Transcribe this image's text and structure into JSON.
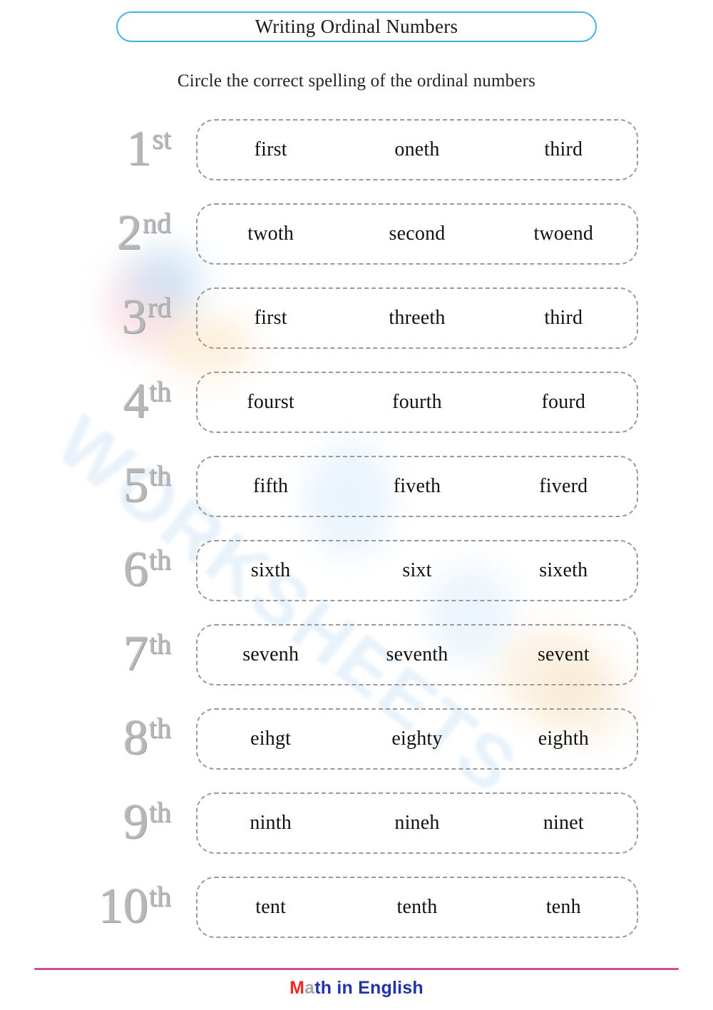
{
  "page": {
    "title": "Writing Ordinal Numbers",
    "instruction": "Circle the correct spelling of the ordinal numbers"
  },
  "colors": {
    "title_border": "#42b4e6",
    "ordinal_gray": "#b7b7b7",
    "box_border": "#9a9a9a",
    "footer_rule": "#cc4d99",
    "brand_m": "#ee2b24",
    "brand_a": "#a8a8a8",
    "brand_rest": "#2233aa",
    "watermark_blue": "#bcd9f2"
  },
  "watermark": {
    "text": "WORKSHEETS"
  },
  "rows": [
    {
      "number": "1",
      "suffix": "st",
      "choices": [
        "first",
        "oneth",
        "third"
      ]
    },
    {
      "number": "2",
      "suffix": "nd",
      "choices": [
        "twoth",
        "second",
        "twoend"
      ]
    },
    {
      "number": "3",
      "suffix": "rd",
      "choices": [
        "first",
        "threeth",
        "third"
      ]
    },
    {
      "number": "4",
      "suffix": "th",
      "choices": [
        "fourst",
        "fourth",
        "fourd"
      ]
    },
    {
      "number": "5",
      "suffix": "th",
      "choices": [
        "fifth",
        "fiveth",
        "fiverd"
      ]
    },
    {
      "number": "6",
      "suffix": "th",
      "choices": [
        "sixth",
        "sixt",
        "sixeth"
      ]
    },
    {
      "number": "7",
      "suffix": "th",
      "choices": [
        "sevenh",
        "seventh",
        "sevent"
      ]
    },
    {
      "number": "8",
      "suffix": "th",
      "choices": [
        "eihgt",
        "eighty",
        "eighth"
      ]
    },
    {
      "number": "9",
      "suffix": "th",
      "choices": [
        "ninth",
        "nineh",
        "ninet"
      ]
    },
    {
      "number": "10",
      "suffix": "th",
      "choices": [
        "tent",
        "tenth",
        "tenh"
      ]
    }
  ],
  "footer": {
    "brand_m": "M",
    "brand_a": "a",
    "brand_rest": "th in English"
  }
}
